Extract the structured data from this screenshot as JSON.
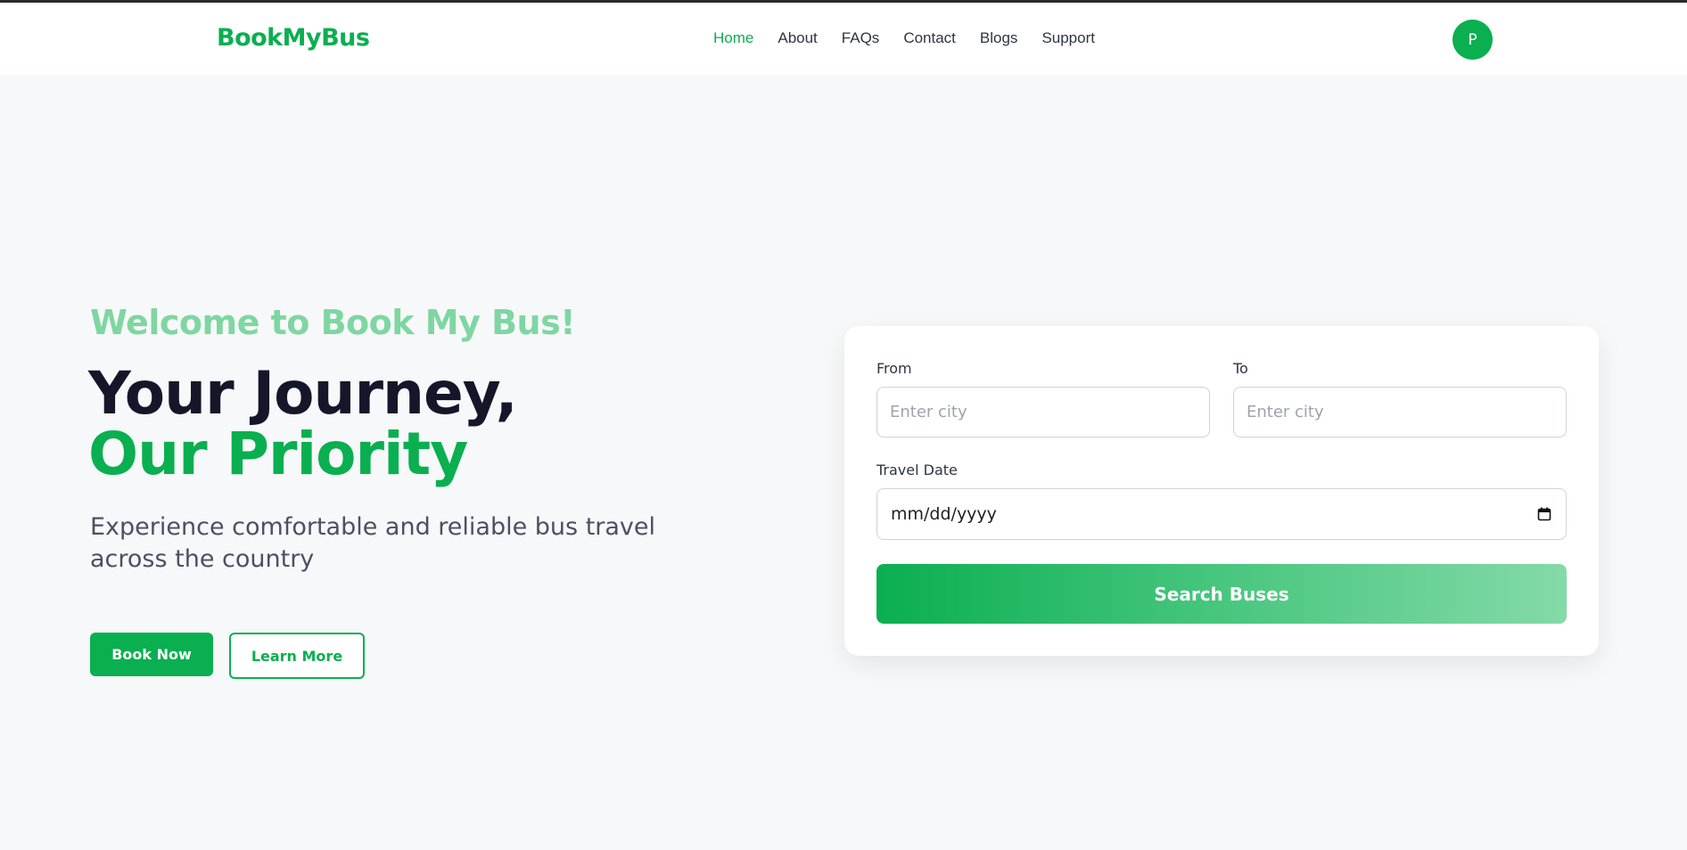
{
  "header": {
    "brand": "BookMyBus",
    "nav": [
      "Home",
      "About",
      "FAQs",
      "Contact",
      "Blogs",
      "Support"
    ],
    "active_nav": "Home",
    "avatar_initial": "P"
  },
  "hero": {
    "welcome": "Welcome to Book My Bus!",
    "headline_line1": "Your Journey,",
    "headline_line2": "Our Priority",
    "subtitle": "Experience comfortable and reliable bus travel across the country",
    "book_now_label": "Book Now",
    "learn_more_label": "Learn More"
  },
  "search_form": {
    "from_label": "From",
    "from_placeholder": "Enter city",
    "to_label": "To",
    "to_placeholder": "Enter city",
    "date_label": "Travel Date",
    "date_value": "mm/dd/yyyy",
    "search_button_label": "Search Buses"
  },
  "colors": {
    "brand": "#0aaf50",
    "brand_light": "#7fd6a2",
    "headline_dark": "#16162a",
    "background": "#f7f8f9"
  },
  "icons": {
    "date_picker": "calendar-icon"
  }
}
